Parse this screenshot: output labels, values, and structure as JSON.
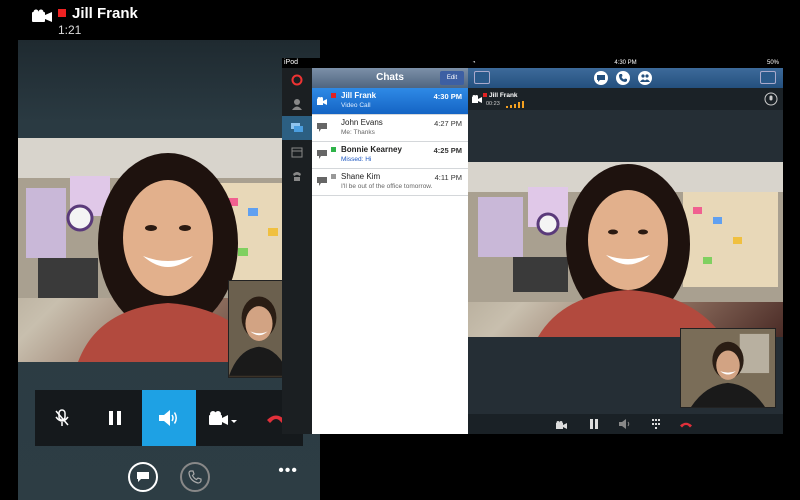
{
  "phone": {
    "contact_name": "Jill Frank",
    "call_duration": "1:21",
    "more_label": "•••"
  },
  "ipod": {
    "status_label": "iPod",
    "header_title": "Chats",
    "edit_label": "Edit",
    "chats": [
      {
        "name": "Jill Frank",
        "subtitle": "Video Call",
        "time": "4:30 PM"
      },
      {
        "name": "John Evans",
        "subtitle": "Me: Thanks",
        "time": "4:27 PM"
      },
      {
        "name": "Bonnie Kearney",
        "subtitle": "Missed: Hi",
        "time": "4:25 PM"
      },
      {
        "name": "Shane Kim",
        "subtitle": "I'll be out of the office tomorrow.",
        "time": "4:11 PM"
      }
    ]
  },
  "ipad": {
    "status_time": "4:30 PM",
    "battery": "50%",
    "contact_name": "Jill Frank",
    "call_duration": "00:23"
  },
  "colors": {
    "accent": "#1ea1e4",
    "busy": "#e22222",
    "available": "#2fb34a",
    "away": "#999999",
    "end_call": "#e0303a"
  }
}
